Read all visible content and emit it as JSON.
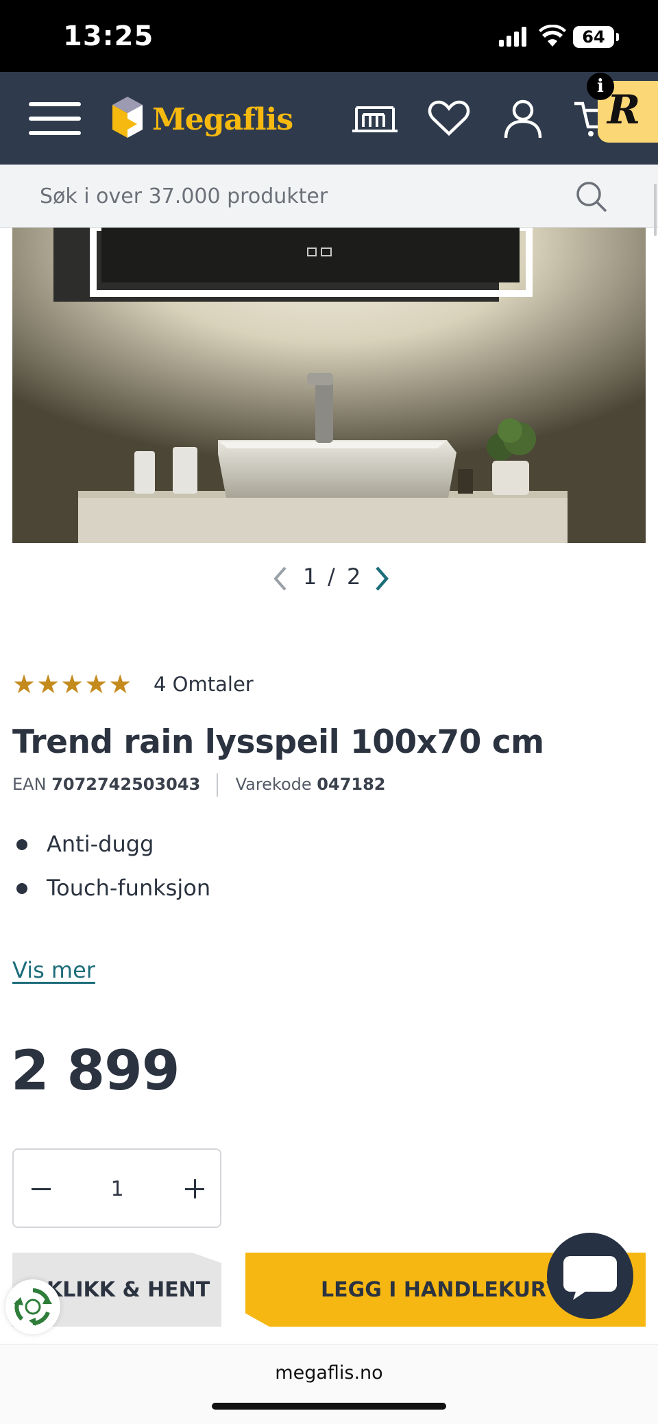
{
  "status_bar": {
    "time": "13:25",
    "battery": "64"
  },
  "header": {
    "logo_text": "Megaflis",
    "notification_badge": "i",
    "extension_badge": "R"
  },
  "search": {
    "placeholder": "Søk i over 37.000 produkter"
  },
  "gallery": {
    "current": "1",
    "separator": "/",
    "total": "2"
  },
  "rating": {
    "stars": "★★★★★",
    "value": 5,
    "reviews": "4 Omtaler"
  },
  "product": {
    "title": "Trend rain lysspeil 100x70 cm",
    "ean_label": "EAN",
    "ean": "7072742503043",
    "sku_label": "Varekode",
    "sku": "047182",
    "features": [
      "Anti-dugg",
      "Touch-funksjon"
    ],
    "show_more": "Vis mer",
    "price": "2 899"
  },
  "cart": {
    "quantity": "1",
    "click_collect_label": "KLIKK & HENT",
    "add_to_cart_label": "LEGG I HANDLEKURV"
  },
  "browser": {
    "url": "megaflis.no"
  },
  "colors": {
    "header_bg": "#2f3b4c",
    "brand_yellow": "#f6b90f",
    "cta_yellow": "#f7b713",
    "link": "#1d6d7a",
    "star": "#c48a1d",
    "text": "#2b3340"
  },
  "icons": [
    "hamburger-icon",
    "store-icon",
    "heart-icon",
    "user-icon",
    "cart-icon",
    "search-icon",
    "chevron-left-icon",
    "chevron-right-icon",
    "chat-icon",
    "recycle-icon"
  ]
}
